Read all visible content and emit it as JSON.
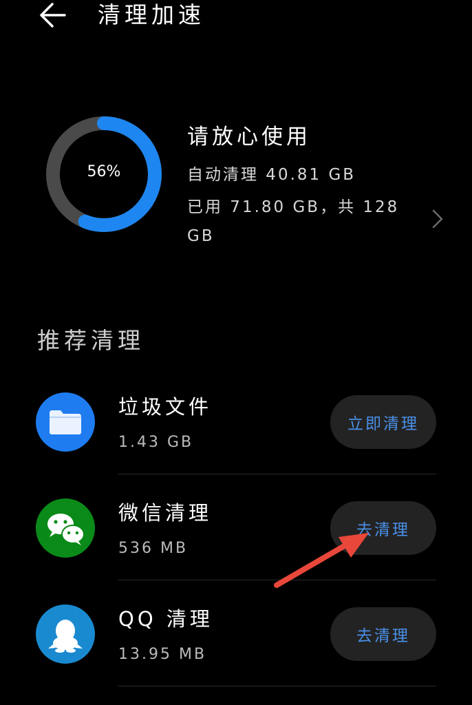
{
  "header": {
    "title": "清理加速"
  },
  "storage": {
    "percent_label": "56%",
    "percent": 0.56,
    "status_title": "请放心使用",
    "auto_clean": "自动清理 40.81 GB",
    "usage": "已用 71.80 GB，共 128 GB"
  },
  "section": {
    "title": "推荐清理"
  },
  "items": [
    {
      "name": "垃圾文件",
      "size": "1.43 GB",
      "button": "立即清理",
      "icon": "folder-icon",
      "icon_color": "#1e7cf0"
    },
    {
      "name": "微信清理",
      "size": "536 MB",
      "button": "去清理",
      "icon": "wechat-icon",
      "icon_color": "#0a8a18"
    },
    {
      "name": "QQ 清理",
      "size": "13.95 MB",
      "button": "去清理",
      "icon": "qq-penguin-icon",
      "icon_color": "#1a8ad0"
    }
  ],
  "colors": {
    "accent": "#4a90e8",
    "ring_track": "#4a4a4a",
    "arrow": "#e8473a"
  }
}
